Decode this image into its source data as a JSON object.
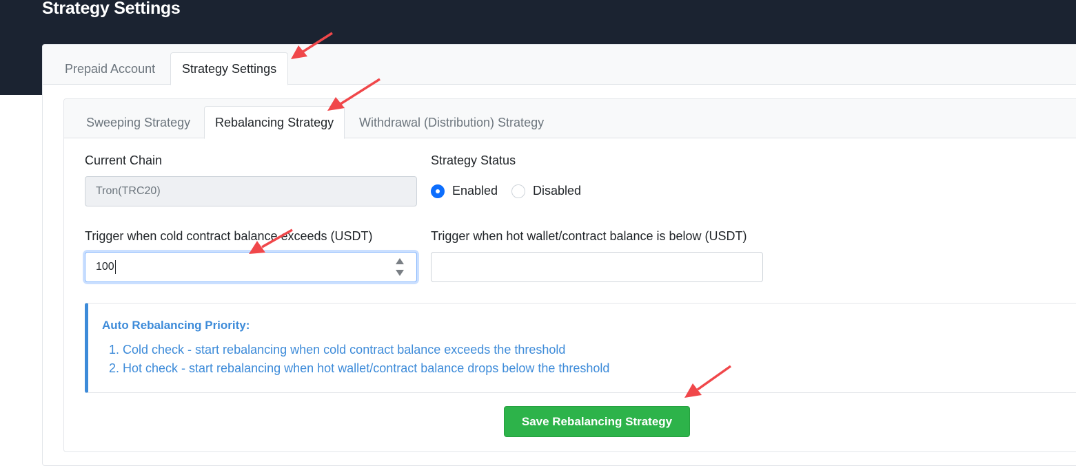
{
  "page": {
    "title": "Strategy Settings"
  },
  "outer_tabs": [
    {
      "label": "Prepaid Account",
      "active": false
    },
    {
      "label": "Strategy Settings",
      "active": true
    }
  ],
  "inner_tabs": [
    {
      "label": "Sweeping Strategy",
      "active": false
    },
    {
      "label": "Rebalancing Strategy",
      "active": true
    },
    {
      "label": "Withdrawal (Distribution) Strategy",
      "active": false
    }
  ],
  "form": {
    "current_chain": {
      "label": "Current Chain",
      "value": "Tron(TRC20)"
    },
    "strategy_status": {
      "label": "Strategy Status",
      "options": [
        "Enabled",
        "Disabled"
      ],
      "selected": "Enabled"
    },
    "cold_threshold": {
      "label": "Trigger when cold contract balance exceeds (USDT)",
      "value": "100"
    },
    "hot_threshold": {
      "label": "Trigger when hot wallet/contract balance is below (USDT)",
      "value": ""
    }
  },
  "info": {
    "title": "Auto Rebalancing Priority:",
    "lines": [
      "1. Cold check - start rebalancing when cold contract balance exceeds the threshold",
      "2. Hot check - start rebalancing when hot wallet/contract balance drops below the threshold"
    ]
  },
  "actions": {
    "save_label": "Save Rebalancing Strategy"
  },
  "colors": {
    "topbar": "#1b2331",
    "primary": "#0d6efd",
    "info": "#3d8bd9",
    "save": "#2db34a",
    "annotation_arrow": "#f0474a"
  }
}
